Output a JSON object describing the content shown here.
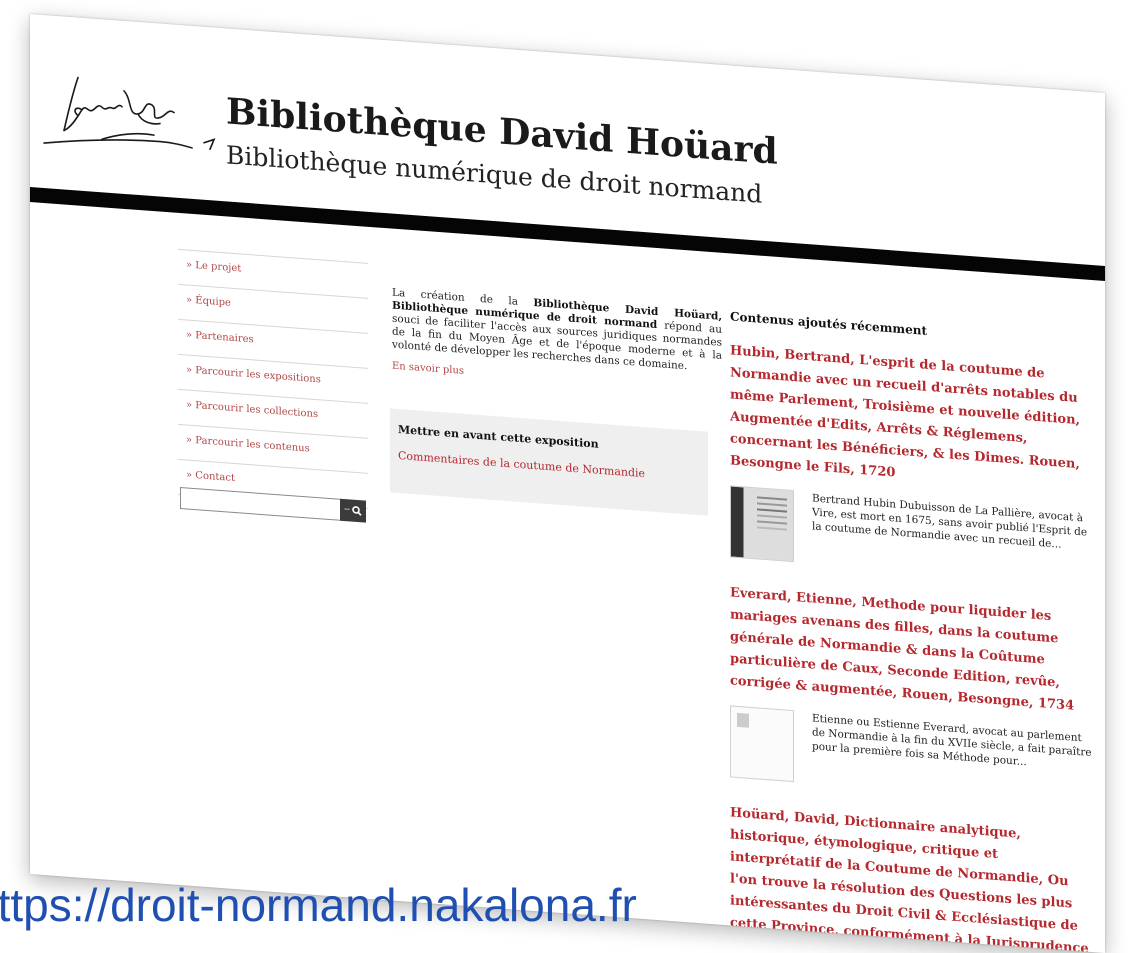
{
  "header": {
    "title": "Bibliothèque David Hoüard",
    "subtitle": "Bibliothèque numérique de droit normand"
  },
  "nav": {
    "items": [
      {
        "label": "» Le projet"
      },
      {
        "label": "» Équipe"
      },
      {
        "label": "» Partenaires"
      },
      {
        "label": "» Parcourir les expositions"
      },
      {
        "label": "» Parcourir les collections"
      },
      {
        "label": "» Parcourir les contenus"
      },
      {
        "label": "» Contact"
      }
    ],
    "search": {
      "placeholder": "",
      "button_icon": "search-icon"
    }
  },
  "intro": {
    "prefix": "La création de la ",
    "bold": "Bibliothèque David Hoüard, Bibliothèque numérique de droit normand",
    "suffix": " répond au souci de faciliter l'accès aux sources juridiques normandes de la fin du Moyen Âge et de l'époque moderne et à la volonté de développer les recherches dans ce domaine.",
    "read_more": "En savoir plus"
  },
  "featured": {
    "heading": "Mettre en avant cette exposition",
    "link": "Commentaires de la coutume de Normandie"
  },
  "recent": {
    "heading": "Contenus ajoutés récemment",
    "items": [
      {
        "title": "Hubin, Bertrand, L'esprit de la coutume de Normandie avec un recueil d'arrêts notables du même Parlement, Troisième et nouvelle édition, Augmentée d'Edits, Arrêts & Réglemens, concernant les Bénéficiers, & les Dimes. Rouen, Besongne le Fils, 1720",
        "description": "Bertrand Hubin Dubuisson de La Pallière, avocat à Vire, est mort en 1675, sans avoir publié l'Esprit de la coutume de Normandie avec un recueil de..."
      },
      {
        "title": "Everard, Etienne, Methode pour liquider les mariages avenans des filles, dans la coutume générale de Normandie & dans la Coûtume particulière de Caux, Seconde Edition, revûe, corrigée & augmentée, Rouen, Besongne, 1734",
        "description": "Etienne ou Estienne Everard, avocat au parlement de Normandie à la fin du XVIIe siècle, a fait paraître pour la première fois sa Méthode pour..."
      },
      {
        "title": "Hoüard, David, Dictionnaire analytique, historique, étymologique, critique et interprétatif de la Coutume de Normandie, Ou l'on trouve la résolution des Questions les plus intéressantes du Droit Civil & Ecclésiastique de cette Province, conformément à la Jurisprudence des Arrêts.Tome"
      }
    ]
  },
  "caption": {
    "url": "https://droit-normand.nakalona.fr"
  },
  "colors": {
    "accent": "#b4282e",
    "nav_link": "#b04848",
    "header_rule": "#050505",
    "url_caption": "#1f4fb0"
  }
}
